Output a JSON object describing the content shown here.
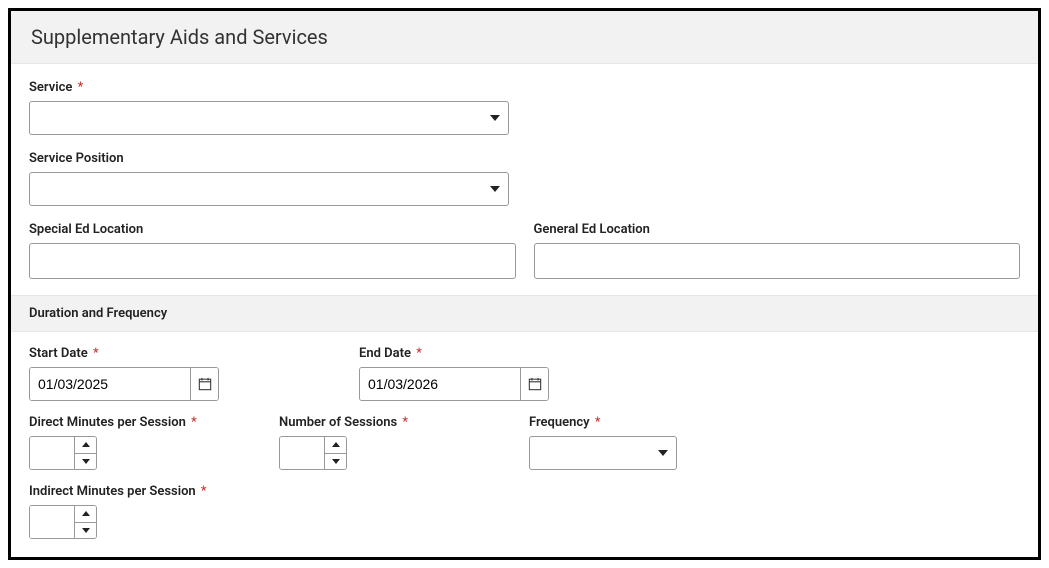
{
  "header": {
    "title": "Supplementary Aids and Services"
  },
  "fields": {
    "service": {
      "label": "Service",
      "required": "*",
      "value": ""
    },
    "servicePosition": {
      "label": "Service Position",
      "value": ""
    },
    "specialEdLocation": {
      "label": "Special Ed Location",
      "value": ""
    },
    "generalEdLocation": {
      "label": "General Ed Location",
      "value": ""
    }
  },
  "subsection": {
    "title": "Duration and Frequency"
  },
  "duration": {
    "startDate": {
      "label": "Start Date",
      "required": "*",
      "value": "01/03/2025"
    },
    "endDate": {
      "label": "End Date",
      "required": "*",
      "value": "01/03/2026"
    },
    "directMinutes": {
      "label": "Direct Minutes per Session",
      "required": "*",
      "value": ""
    },
    "numberOfSessions": {
      "label": "Number of Sessions",
      "required": "*",
      "value": ""
    },
    "frequency": {
      "label": "Frequency",
      "required": "*",
      "value": ""
    },
    "indirectMinutes": {
      "label": "Indirect Minutes per Session",
      "required": "*",
      "value": ""
    }
  }
}
